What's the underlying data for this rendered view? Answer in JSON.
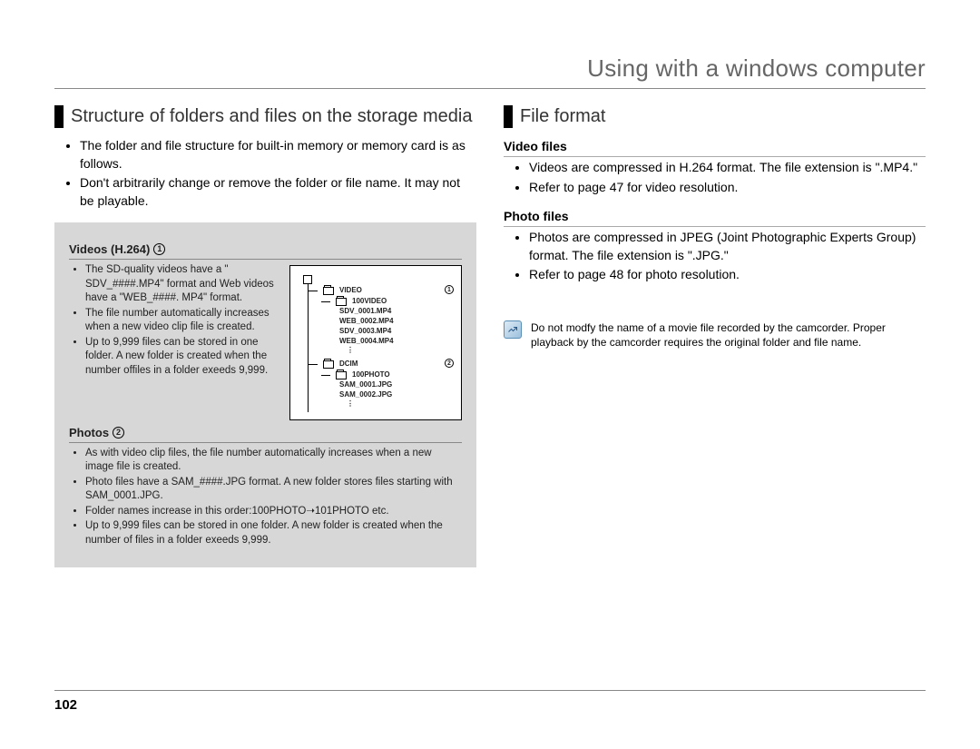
{
  "header": {
    "title": "Using with a windows computer"
  },
  "left": {
    "sectionTitle": "Structure of folders and files on the storage media",
    "intro": {
      "i0": "The folder and file structure for built-in memory or memory card is as follows.",
      "i1": "Don't arbitrarily change or remove the folder or file name. It may not be playable."
    },
    "videosHead": "Videos (H.264)",
    "videosList": {
      "v0": "The SD-quality videos have a \" SDV_####.MP4\" format and Web videos have a \"WEB_####. MP4\" format.",
      "v1": "The file number automatically increases when a new video clip file is created.",
      "v2": "Up to 9,999 files can be stored in one folder. A new folder is created when the number offiles in a folder exeeds 9,999."
    },
    "photosHead": "Photos",
    "photosList": {
      "p0": "As with video clip files, the file number automatically increases when a new image file is created.",
      "p1": "Photo files have a SAM_####.JPG format. A new folder stores files starting with SAM_0001.JPG.",
      "p2": "Folder names increase in this order:100PHOTO➝101PHOTO etc.",
      "p3": "Up to 9,999 files can be stored in one folder. A new folder is created when the number of files in a folder exeeds 9,999."
    },
    "diagram": {
      "video": "VIDEO",
      "video100": "100VIDEO",
      "f1": "SDV_0001.MP4",
      "f2": "WEB_0002.MP4",
      "f3": "SDV_0003.MP4",
      "f4": "WEB_0004.MP4",
      "dcim": "DCIM",
      "photo100": "100PHOTO",
      "pf1": "SAM_0001.JPG",
      "pf2": "SAM_0002.JPG",
      "num1": "1",
      "num2": "2"
    }
  },
  "right": {
    "sectionTitle": "File format",
    "videoHead": "Video files",
    "videoList": {
      "v0": "Videos are compressed in H.264 format. The file extension is \".MP4.\"",
      "v1": "Refer to page 47 for video resolution."
    },
    "photoHead": "Photo files",
    "photoList": {
      "p0": "Photos are compressed in JPEG (Joint Photographic Experts Group) format. The file extension is \".JPG.\"",
      "p1": "Refer to page 48 for photo resolution."
    },
    "note": "Do not modfy the name of a movie file recorded by the camcorder. Proper playback by the camcorder requires the original folder and file name."
  },
  "pageNumber": "102",
  "circled": {
    "one": "1",
    "two": "2"
  }
}
